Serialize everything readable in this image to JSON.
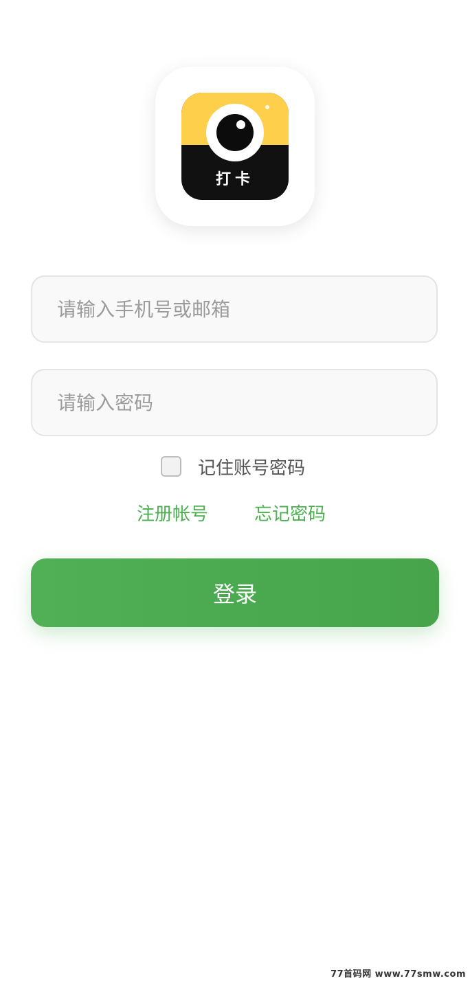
{
  "app": {
    "logo_text": "打卡",
    "colors": {
      "logo_yellow": "#fdcf4a",
      "logo_black": "#111111",
      "accent_green": "#4caf50"
    }
  },
  "form": {
    "account_placeholder": "请输入手机号或邮箱",
    "account_value": "",
    "password_placeholder": "请输入密码",
    "password_value": "",
    "remember_label": "记住账号密码",
    "remember_checked": false
  },
  "links": {
    "register": "注册帐号",
    "forgot": "忘记密码"
  },
  "actions": {
    "login_label": "登录"
  },
  "watermark": {
    "text": "77首码网 www.77smw.com"
  }
}
